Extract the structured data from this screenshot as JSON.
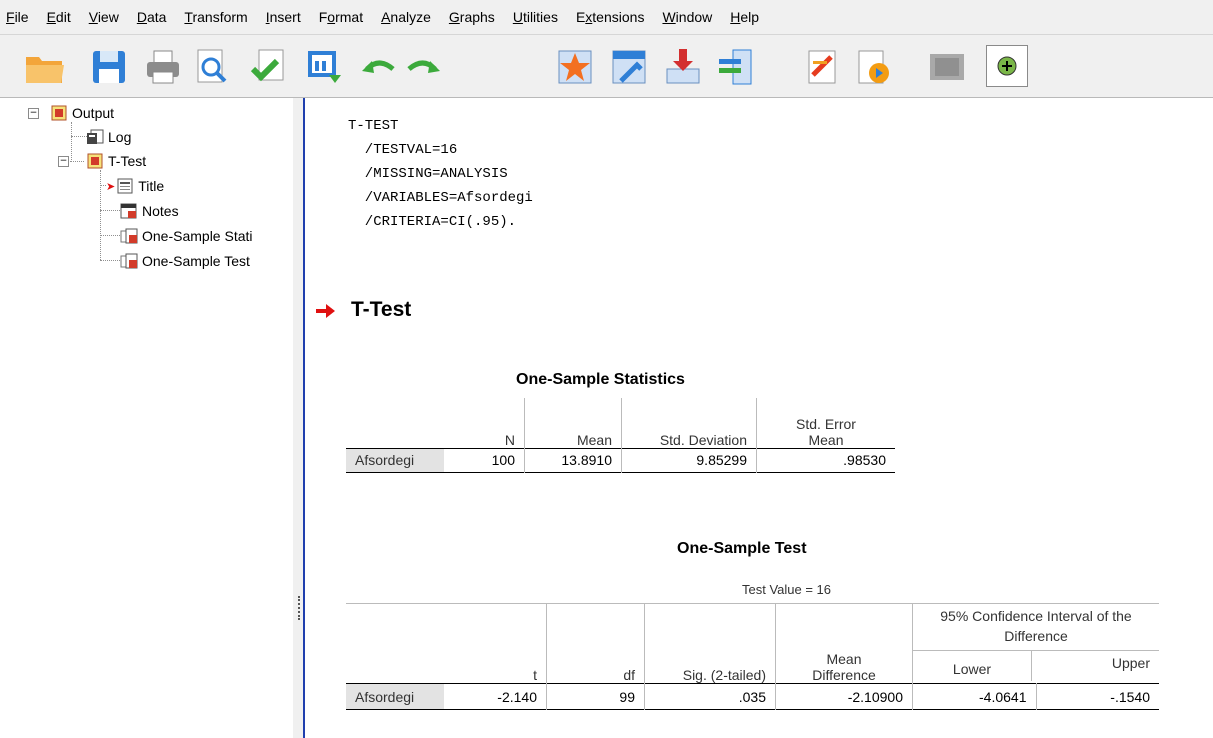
{
  "menu": [
    {
      "label": "File",
      "key": "F",
      "rest": "ile"
    },
    {
      "label": "Edit",
      "key": "E",
      "rest": "dit"
    },
    {
      "label": "View",
      "key": "V",
      "rest": "iew"
    },
    {
      "label": "Data",
      "key": "D",
      "rest": "ata"
    },
    {
      "label": "Transform",
      "key": "T",
      "rest": "ransform"
    },
    {
      "label": "Insert",
      "key": "I",
      "rest": "nsert"
    },
    {
      "label": "Format",
      "key": "o",
      "pre": "F",
      "rest": "rmat"
    },
    {
      "label": "Analyze",
      "key": "A",
      "rest": "nalyze"
    },
    {
      "label": "Graphs",
      "key": "G",
      "rest": "raphs"
    },
    {
      "label": "Utilities",
      "key": "U",
      "rest": "tilities"
    },
    {
      "label": "Extensions",
      "key": "x",
      "pre": "E",
      "rest": "tensions"
    },
    {
      "label": "Window",
      "key": "W",
      "rest": "indow"
    },
    {
      "label": "Help",
      "key": "H",
      "rest": "elp"
    }
  ],
  "toolbar": {
    "icons": [
      "open-icon",
      "save-icon",
      "print-icon",
      "print-preview-icon",
      "export-icon",
      "recall-dialog-icon",
      "undo-icon",
      "redo-icon",
      "goto-data-icon",
      "goto-variable-icon",
      "insert-cases-icon",
      "split-file-icon",
      "designate-window-icon",
      "select-output-icon",
      "disabled-icon",
      "create-script-icon"
    ]
  },
  "tree": {
    "root": "Output",
    "log": "Log",
    "ttest": "T-Test",
    "title": "Title",
    "notes": "Notes",
    "stats": "One-Sample Stati",
    "test": "One-Sample Test"
  },
  "syntax": {
    "line1": "T-TEST",
    "line2": "  /TESTVAL=16",
    "line3": "  /MISSING=ANALYSIS",
    "line4": "  /VARIABLES=Afsordegi",
    "line5": "  /CRITERIA=CI(.95)."
  },
  "section": {
    "title": "T-Test"
  },
  "stats_table": {
    "title": "One-Sample Statistics",
    "headers": {
      "n": "N",
      "mean": "Mean",
      "sd": "Std. Deviation",
      "se1": "Std. Error",
      "se2": "Mean"
    },
    "row": {
      "label": "Afsordegi",
      "n": "100",
      "mean": "13.8910",
      "sd": "9.85299",
      "se": ".98530"
    }
  },
  "test_table": {
    "title": "One-Sample Test",
    "test_value": "Test Value = 16",
    "ci_header1": "95% Confidence Interval of the",
    "ci_header2": "Difference",
    "headers": {
      "t": "t",
      "df": "df",
      "sig": "Sig. (2-tailed)",
      "md1": "Mean",
      "md2": "Difference",
      "lower": "Lower",
      "upper": "Upper"
    },
    "row": {
      "label": "Afsordegi",
      "t": "-2.140",
      "df": "99",
      "sig": ".035",
      "md": "-2.10900",
      "lower": "-4.0641",
      "upper": "-.1540"
    }
  },
  "colors": {
    "accent": "#1f3fae",
    "arrow": "#e01010",
    "rowhdr": "#e3e3e3"
  }
}
